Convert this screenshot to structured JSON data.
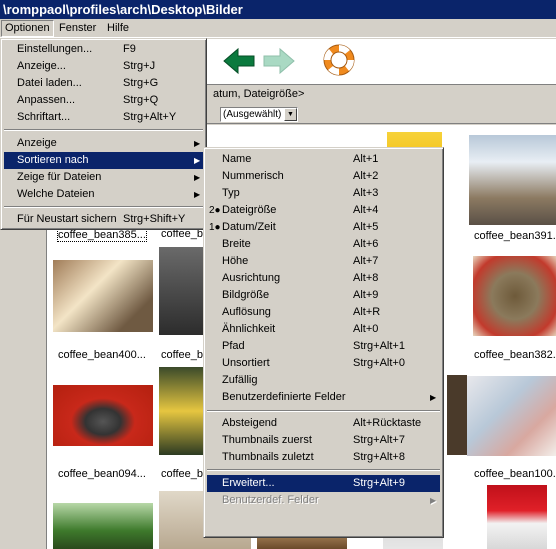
{
  "window": {
    "title": "\\romppaol\\profiles\\arch\\Desktop\\Bilder"
  },
  "menubar": [
    "Optionen",
    "Fenster",
    "Hilfe"
  ],
  "sort_label": "atum, Dateigröße>",
  "combo_value": "(Ausgewählt)",
  "options_menu": [
    {
      "label": "Einstellungen...",
      "shortcut": "F9"
    },
    {
      "label": "Anzeige...",
      "shortcut": "Strg+J"
    },
    {
      "label": "Datei laden...",
      "shortcut": "Strg+G"
    },
    {
      "label": "Anpassen...",
      "shortcut": "Strg+Q"
    },
    {
      "label": "Schriftart...",
      "shortcut": "Strg+Alt+Y"
    },
    {
      "label": "Anzeige",
      "shortcut": ""
    },
    {
      "label": "Sortieren nach",
      "shortcut": ""
    },
    {
      "label": "Zeige für Dateien",
      "shortcut": ""
    },
    {
      "label": "Welche Dateien",
      "shortcut": ""
    },
    {
      "label": "Für Neustart sichern",
      "shortcut": "Strg+Shift+Y"
    }
  ],
  "sort_menu": [
    {
      "label": "Name",
      "shortcut": "Alt+1",
      "mark": ""
    },
    {
      "label": "Nummerisch",
      "shortcut": "Alt+2",
      "mark": ""
    },
    {
      "label": "Typ",
      "shortcut": "Alt+3",
      "mark": ""
    },
    {
      "label": "Dateigröße",
      "shortcut": "Alt+4",
      "mark": "2●"
    },
    {
      "label": "Datum/Zeit",
      "shortcut": "Alt+5",
      "mark": "1●"
    },
    {
      "label": "Breite",
      "shortcut": "Alt+6",
      "mark": ""
    },
    {
      "label": "Höhe",
      "shortcut": "Alt+7",
      "mark": ""
    },
    {
      "label": "Ausrichtung",
      "shortcut": "Alt+8",
      "mark": ""
    },
    {
      "label": "Bildgröße",
      "shortcut": "Alt+9",
      "mark": ""
    },
    {
      "label": "Auflösung",
      "shortcut": "Alt+R",
      "mark": ""
    },
    {
      "label": "Ähnlichkeit",
      "shortcut": "Alt+0",
      "mark": ""
    },
    {
      "label": "Pfad",
      "shortcut": "Strg+Alt+1",
      "mark": ""
    },
    {
      "label": "Unsortiert",
      "shortcut": "Strg+Alt+0",
      "mark": ""
    },
    {
      "label": "Zufällig",
      "shortcut": "",
      "mark": ""
    },
    {
      "label": "Benutzerdefinierte Felder",
      "shortcut": "",
      "mark": ""
    },
    {
      "label": "Absteigend",
      "shortcut": "Alt+Rücktaste",
      "mark": ""
    },
    {
      "label": "Thumbnails zuerst",
      "shortcut": "Strg+Alt+7",
      "mark": ""
    },
    {
      "label": "Thumbnails zuletzt",
      "shortcut": "Strg+Alt+8",
      "mark": ""
    },
    {
      "label": "Erweitert...",
      "shortcut": "Strg+Alt+9",
      "mark": ""
    },
    {
      "label": "Benutzerdef. Felder",
      "shortcut": "",
      "mark": ""
    }
  ],
  "captions": [
    "coffee_bean385...",
    "coffee_b",
    "coffee_bean391...",
    "coffee_bean400...",
    "coffee_b",
    "coffee_bean382...",
    "coffee_bean094...",
    "coffee_b",
    "coffee_bean100..."
  ],
  "colors": {
    "titlebar": "#0a246a",
    "highlight": "#0a246a",
    "menu_bg": "#d4d0c8",
    "arrow_green": "#0b7a3e"
  }
}
